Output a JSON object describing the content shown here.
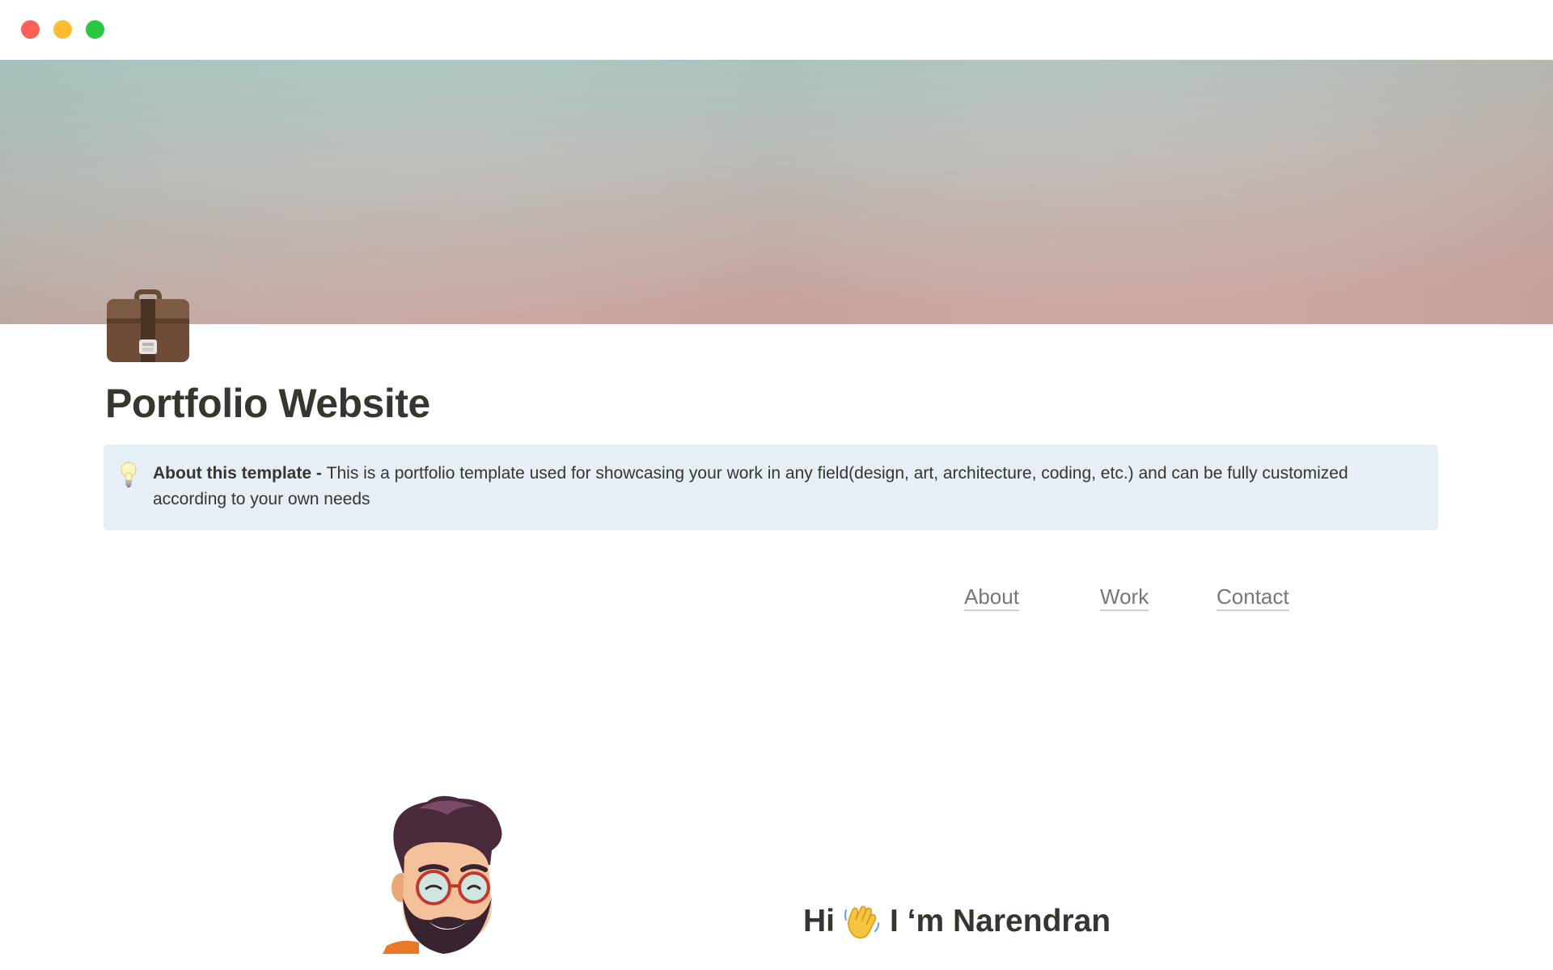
{
  "window": {
    "controls": [
      "close",
      "minimize",
      "maximize"
    ],
    "colors": {
      "close": "#ff5f57",
      "minimize": "#febc2e",
      "maximize": "#28c840"
    }
  },
  "cover": {
    "colors": {
      "top": "#a8c5c0",
      "middle": "#bdb7b3",
      "bottom": "#c8a09a"
    }
  },
  "page": {
    "icon": "briefcase-icon",
    "title": "Portfolio Website"
  },
  "callout": {
    "icon": "lightbulb-icon",
    "bold_text": "About this template - ",
    "text": " This is a portfolio template used for showcasing your work in any field(design, art, architecture, coding, etc.) and can be fully customized according to your own needs",
    "background": "#e7eff6"
  },
  "nav": {
    "links": [
      {
        "label": "About"
      },
      {
        "label": "Work"
      },
      {
        "label": "Contact"
      }
    ]
  },
  "hero": {
    "avatar": "bearded-man-avatar",
    "greeting_prefix": "Hi",
    "greeting_icon": "waving-hand-icon",
    "greeting_suffix": "I ‘m Narendran"
  }
}
